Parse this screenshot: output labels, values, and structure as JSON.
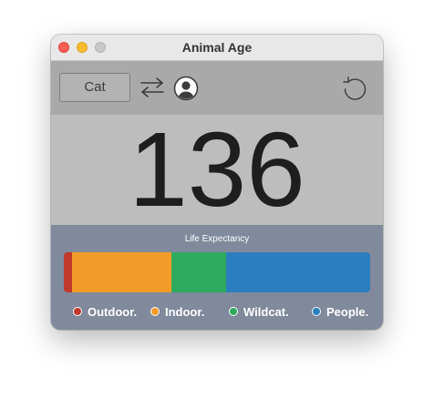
{
  "window": {
    "title": "Animal Age"
  },
  "toolbar": {
    "animal_label": "Cat",
    "icons": [
      "swap-arrows-icon",
      "person-icon",
      "reset-icon"
    ]
  },
  "age": {
    "value": "136"
  },
  "life_expectancy": {
    "title": "Life Expectancy",
    "segments": [
      {
        "name": "Outdoor.",
        "color": "#c0392b",
        "fraction": 0.027
      },
      {
        "name": "Indoor.",
        "color": "#f39c29",
        "fraction": 0.325
      },
      {
        "name": "Wildcat.",
        "color": "#2eaa5e",
        "fraction": 0.178
      },
      {
        "name": "People.",
        "color": "#2b7fbe",
        "fraction": 0.47
      }
    ]
  },
  "legend": {
    "items": [
      {
        "label": "Outdoor.",
        "color": "#c0392b"
      },
      {
        "label": "Indoor.",
        "color": "#f39c29"
      },
      {
        "label": "Wildcat.",
        "color": "#2eaa5e"
      },
      {
        "label": "People.",
        "color": "#2b7fbe"
      }
    ]
  }
}
